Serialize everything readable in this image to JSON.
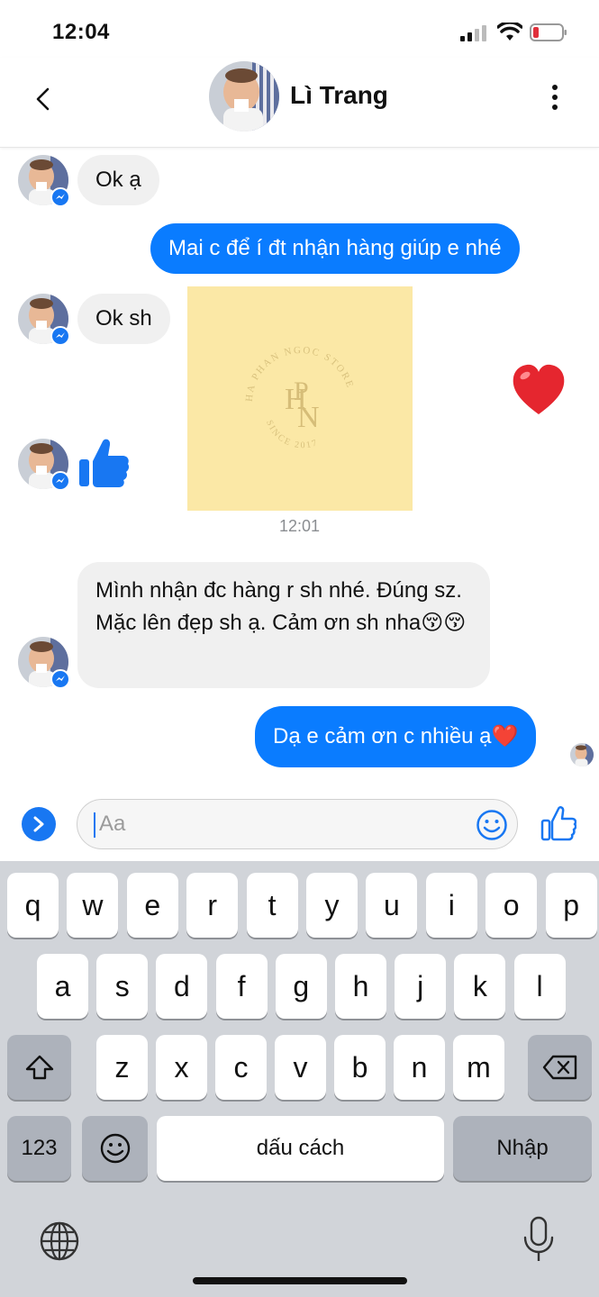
{
  "status_bar": {
    "time": "12:04"
  },
  "header": {
    "contact_name": "Lì Trang"
  },
  "messages": {
    "m1": "Ok ạ",
    "m2": "Mai c để í đt nhận hàng giúp e nhé",
    "m3": "Ok sh",
    "m4": "Mình nhận đc hàng r sh nhé. Đúng sz. Mặc lên đẹp sh ạ. Cảm ơn sh nha😚😚",
    "m5": "Dạ e cảm ơn c nhiều ạ❤️"
  },
  "photo": {
    "watermark_text_top": "HA PHAN NGOC STORE",
    "watermark_text_bottom": "SINCE 2017",
    "watermark_monogram": "HPN"
  },
  "timestamp": "12:01",
  "composer": {
    "placeholder": "Aa"
  },
  "keyboard": {
    "row1": [
      "q",
      "w",
      "e",
      "r",
      "t",
      "y",
      "u",
      "i",
      "o",
      "p"
    ],
    "row2": [
      "a",
      "s",
      "d",
      "f",
      "g",
      "h",
      "j",
      "k",
      "l"
    ],
    "row3": [
      "z",
      "x",
      "c",
      "v",
      "b",
      "n",
      "m"
    ],
    "numbers_key": "123",
    "space_key": "dấu cách",
    "return_key": "Nhập"
  },
  "colors": {
    "outgoing_bubble": "#0a7cff",
    "incoming_bubble": "#f0f0f0",
    "messenger_blue": "#1877f2",
    "photo_bg": "#fbe8a6",
    "keyboard_bg": "#d1d4d9"
  }
}
